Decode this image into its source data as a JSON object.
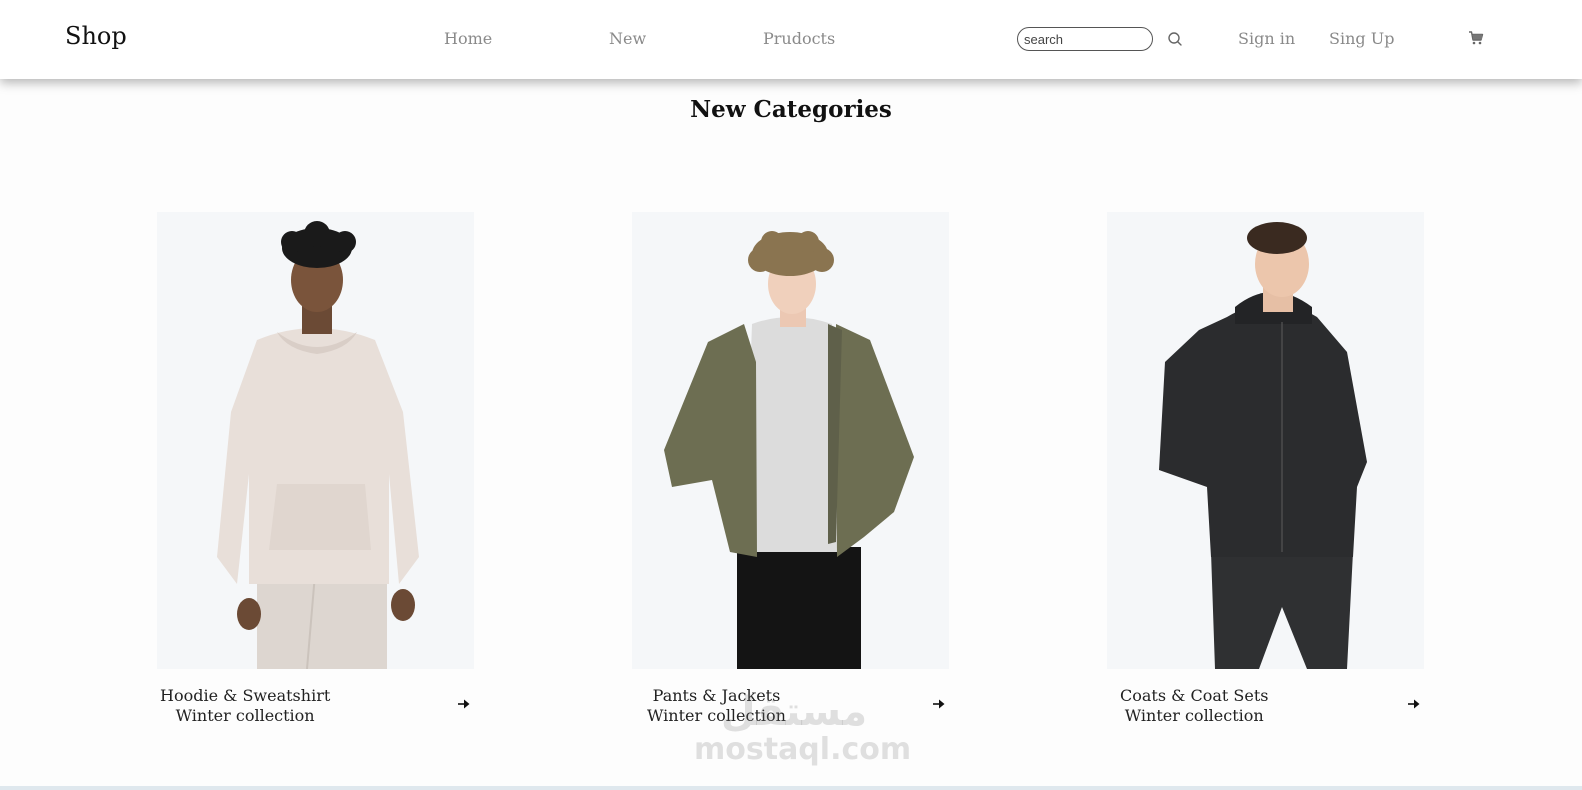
{
  "header": {
    "logo": "Shop",
    "nav": [
      "Home",
      "New",
      "Prudocts"
    ],
    "search": {
      "placeholder": "search",
      "value": ""
    },
    "sign_in": "Sign in",
    "sign_up": "Sing Up",
    "icons": {
      "search": "magnifier-icon",
      "cart": "cart-icon"
    }
  },
  "main": {
    "title": "New Categories",
    "cards": [
      {
        "title": "Hoodie & Sweatshirt",
        "subtitle": "Winter collection",
        "image": "model in beige hoodie and sweatpants",
        "colors": {
          "garment": "#e8dfd9"
        }
      },
      {
        "title": "Pants & Jackets",
        "subtitle": "Winter collection",
        "image": "model in olive jacket, grey t-shirt and black pants",
        "colors": {
          "garment": "#6d6e52"
        }
      },
      {
        "title": "Coats & Coat Sets",
        "subtitle": "Winter collection",
        "image": "model in dark patterned hooded coat set",
        "colors": {
          "garment": "#2b2c2e"
        }
      }
    ]
  },
  "watermark": {
    "arabic": "مستقل",
    "latin": "mostaql.com"
  },
  "colors": {
    "header_bg": "#ffffff",
    "nav_text": "#8a8a8a",
    "card_bg": "#f5f7f9"
  }
}
